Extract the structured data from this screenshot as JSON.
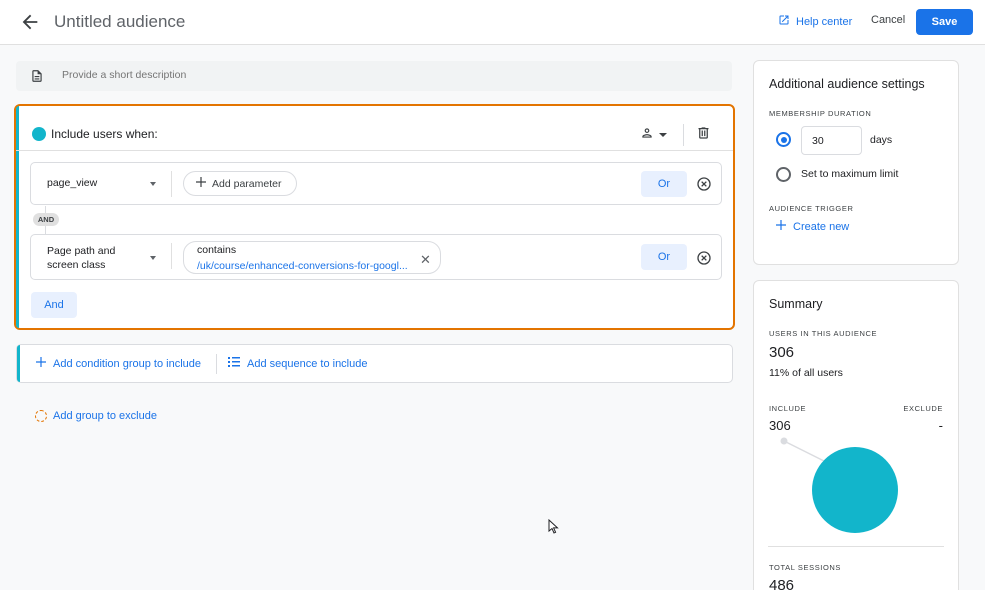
{
  "header": {
    "title": "Untitled audience",
    "help_label": "Help center",
    "cancel_label": "Cancel",
    "save_label": "Save"
  },
  "description": {
    "placeholder": "Provide a short description"
  },
  "include_group": {
    "label": "Include users when:",
    "accent_color": "#12b5cb",
    "highlight_color": "#e37400",
    "conditions": [
      {
        "dimension": "page_view",
        "add_param_label": "Add parameter",
        "or_label": "Or"
      },
      {
        "dimension_line1": "Page path and",
        "dimension_line2": "screen class",
        "operator": "contains",
        "value": "/uk/course/enhanced-conversions-for-googl...",
        "or_label": "Or"
      }
    ],
    "and_connector": "AND",
    "and_button": "And"
  },
  "add_bar": {
    "condition_group": "Add condition group to include",
    "sequence": "Add sequence to include"
  },
  "exclude_label": "Add group to exclude",
  "settings": {
    "title": "Additional audience settings",
    "membership_duration": "MEMBERSHIP DURATION",
    "duration_value": "30",
    "days_label": "days",
    "max_limit_label": "Set to maximum limit",
    "trigger_label": "AUDIENCE TRIGGER",
    "create_new_label": "Create new"
  },
  "summary": {
    "title": "Summary",
    "users_label": "USERS IN THIS AUDIENCE",
    "users_value": "306",
    "users_share": "11% of all users",
    "include_label": "INCLUDE",
    "exclude_label": "EXCLUDE",
    "include_value": "306",
    "exclude_value": "-",
    "sessions_label": "TOTAL SESSIONS",
    "sessions_value": "486",
    "pie_color": "#12b5cb"
  }
}
